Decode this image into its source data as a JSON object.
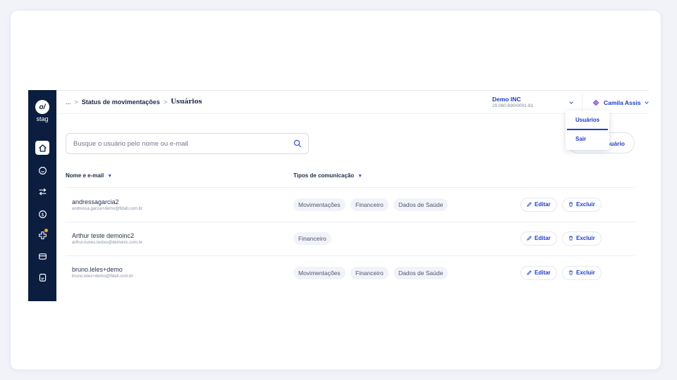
{
  "sidebar": {
    "logo": "o/",
    "env": "stag",
    "nav_icons": [
      "home-icon",
      "smile-icon",
      "transfer-icon",
      "dollar-icon",
      "medical-cross-icon",
      "card-icon",
      "document-icon"
    ]
  },
  "breadcrumb": {
    "ellipsis": "...",
    "separator": ">",
    "parent": "Status de movimentações",
    "current": "Usuários"
  },
  "company": {
    "name": "Demo INC",
    "cnpj": "20.060.690/0001-81"
  },
  "user": {
    "name": "Camila Assis",
    "notifications": "1"
  },
  "user_menu": {
    "items": [
      "Usuários",
      "Sair"
    ]
  },
  "search": {
    "placeholder": "Busque o usuário pelo nome ou e-mail"
  },
  "add_button": {
    "label_visible": "suário"
  },
  "table": {
    "headers": [
      "Nome e e-mail",
      "Tipos de comunicação"
    ],
    "edit_label": "Editar",
    "delete_label": "Excluir",
    "rows": [
      {
        "name": "andressagarcia2",
        "email": "andressa.garcia+demo@fidati.com.br",
        "tags": [
          "Movimentações",
          "Financeiro",
          "Dados de Saúde"
        ]
      },
      {
        "name": "Arthur teste demoinc2",
        "email": "arthur.nunes.testes@demoinc.com.br",
        "tags": [
          "Financeiro"
        ]
      },
      {
        "name": "bruno.leles+demo",
        "email": "bruno.leles+demo@fidati.com.br",
        "tags": [
          "Movimentações",
          "Financeiro",
          "Dados de Saúde"
        ]
      }
    ]
  },
  "colors": {
    "sidebar": "#0b1e40",
    "accent": "#1c3bd1",
    "badge": "#e02a2a"
  }
}
